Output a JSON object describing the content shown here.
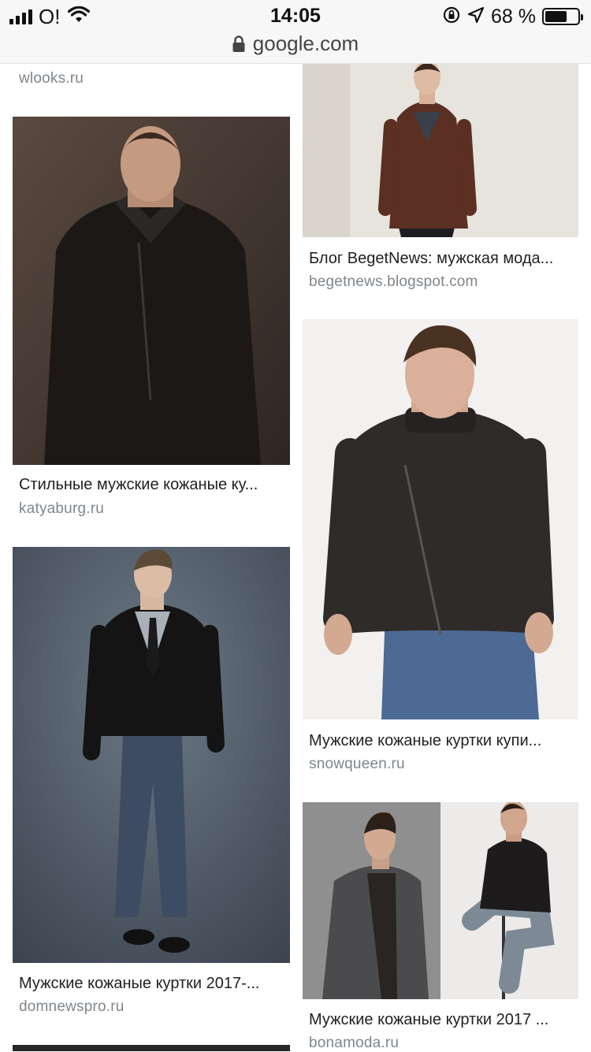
{
  "status_bar": {
    "carrier": "O!",
    "time": "14:05",
    "battery_percent": "68 %",
    "battery_level": 0.68,
    "url": "google.com"
  },
  "results": [
    {
      "title": "",
      "source": "wlooks.ru"
    },
    {
      "title": "Блог BegetNews: мужская мода...",
      "source": "begetnews.blogspot.com"
    },
    {
      "title": "Стильные мужские кожаные ку...",
      "source": "katyaburg.ru"
    },
    {
      "title": "Мужские кожаные куртки купи...",
      "source": "snowqueen.ru"
    },
    {
      "title": "Мужские кожаные куртки 2017-...",
      "source": "domnewspro.ru"
    },
    {
      "title": "Мужские кожаные куртки 2017 ...",
      "source": "bonamoda.ru"
    }
  ],
  "colors": {
    "status_bg": "#f7f7f7",
    "source_text": "#80868b",
    "title_text": "#202124"
  }
}
